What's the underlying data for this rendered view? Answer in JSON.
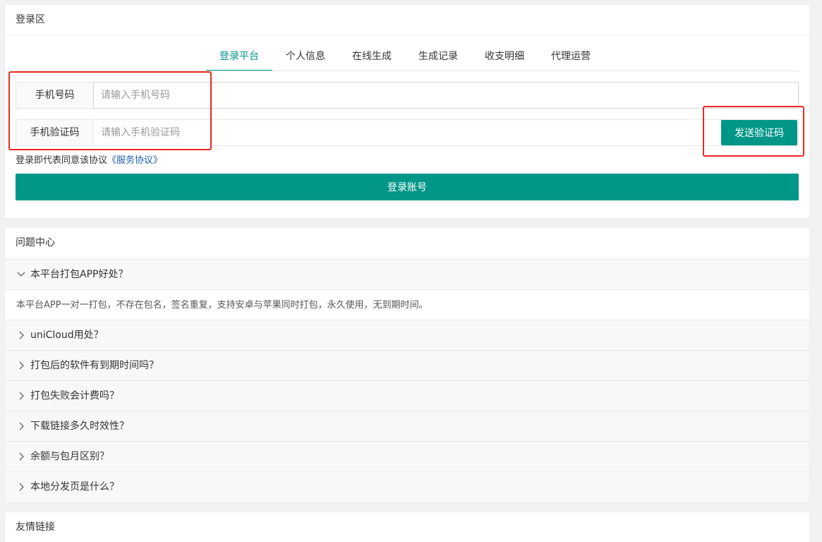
{
  "login": {
    "header": "登录区",
    "tabs": [
      "登录平台",
      "个人信息",
      "在线生成",
      "生成记录",
      "收支明细",
      "代理运营"
    ],
    "active_tab_index": 0,
    "phone_label": "手机号码",
    "phone_placeholder": "请输入手机号码",
    "code_label": "手机验证码",
    "code_placeholder": "请输入手机验证码",
    "send_code_label": "发送验证码",
    "agree_text": "登录即代表同意该协议",
    "agree_link": "《服务协议》",
    "login_button": "登录账号"
  },
  "faq": {
    "header": "问题中心",
    "items": [
      {
        "question": "本平台打包APP好处？",
        "expanded": true,
        "answer": "本平台APP一对一打包，不存在包名，签名重复，支持安卓与苹果同时打包，永久使用，无到期时间。"
      },
      {
        "question": "uniCloud用处？",
        "expanded": false
      },
      {
        "question": "打包后的软件有到期时间吗？",
        "expanded": false
      },
      {
        "question": "打包失败会计费吗？",
        "expanded": false
      },
      {
        "question": "下载链接多久时效性？",
        "expanded": false
      },
      {
        "question": "余额与包月区别？",
        "expanded": false
      },
      {
        "question": "本地分发页是什么？",
        "expanded": false
      }
    ]
  },
  "links": {
    "header": "友情链接"
  },
  "colors": {
    "accent": "#009688",
    "annotation": "#e8291f",
    "background": "#f2f2f2"
  }
}
